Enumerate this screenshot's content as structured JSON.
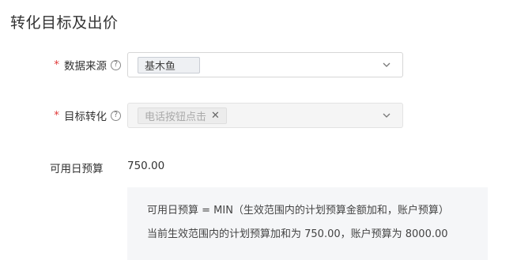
{
  "section": {
    "title": "转化目标及出价"
  },
  "data_source": {
    "required_mark": "*",
    "label": "数据来源",
    "help_icon": "question-circle-icon",
    "selected_tag": "基木鱼",
    "dropdown_icon": "chevron-down-icon"
  },
  "target_conversion": {
    "required_mark": "*",
    "label": "目标转化",
    "help_icon": "question-circle-icon",
    "selected_tag": "电话按钮点击",
    "remove_icon": "close-icon",
    "remove_glyph": "✕",
    "dropdown_icon": "chevron-down-icon",
    "disabled": true
  },
  "budget": {
    "label": "可用日预算",
    "value": "750.00"
  },
  "info": {
    "line1": "可用日预算 = MIN（生效范围内的计划预算金额加和，账户预算）",
    "line2": "当前生效范围内的计划预算加和为 750.00，账户预算为 8000.00"
  },
  "colors": {
    "required_star": "#e03a3a",
    "panel_background": "#f5f6f8",
    "border": "#d6d6d6"
  }
}
